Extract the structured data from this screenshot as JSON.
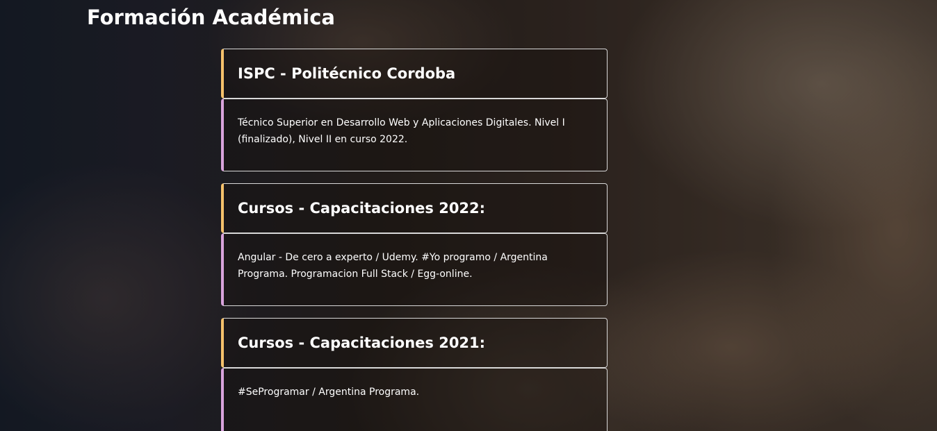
{
  "section": {
    "title": "Formación Académica"
  },
  "entries": [
    {
      "title": "ISPC - Politécnico Cordoba",
      "description": "Técnico Superior en Desarrollo Web y Aplicaciones Digitales. Nivel I (finalizado), Nivel II en curso 2022."
    },
    {
      "title": "Cursos - Capacitaciones 2022:",
      "description": "Angular - De cero a experto / Udemy. #Yo programo / Argentina Programa. Programacion Full Stack / Egg-online."
    },
    {
      "title": "Cursos - Capacitaciones 2021:",
      "description": "#SeProgramar / Argentina Programa."
    }
  ],
  "colors": {
    "header_accent": "#f5c16b",
    "body_accent": "#d9a3dc",
    "card_border": "#d9d9d9",
    "text": "#ffffff"
  }
}
